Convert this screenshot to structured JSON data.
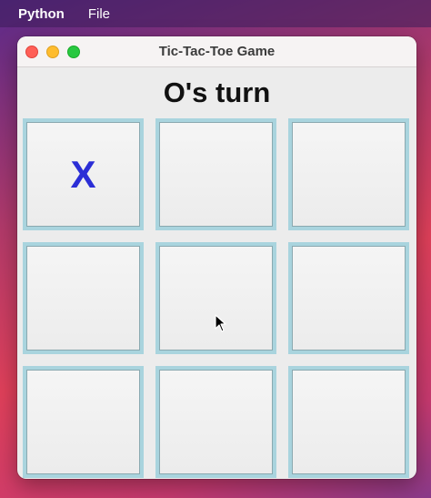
{
  "menubar": {
    "app_name": "Python",
    "menus": [
      "File"
    ]
  },
  "window": {
    "title": "Tic-Tac-Toe Game"
  },
  "game": {
    "status": "O's turn",
    "board": [
      "X",
      "",
      "",
      "",
      "",
      "",
      "",
      "",
      ""
    ]
  },
  "colors": {
    "mark_x": "#2b2ed6",
    "cell_border": "#a9d4de"
  }
}
